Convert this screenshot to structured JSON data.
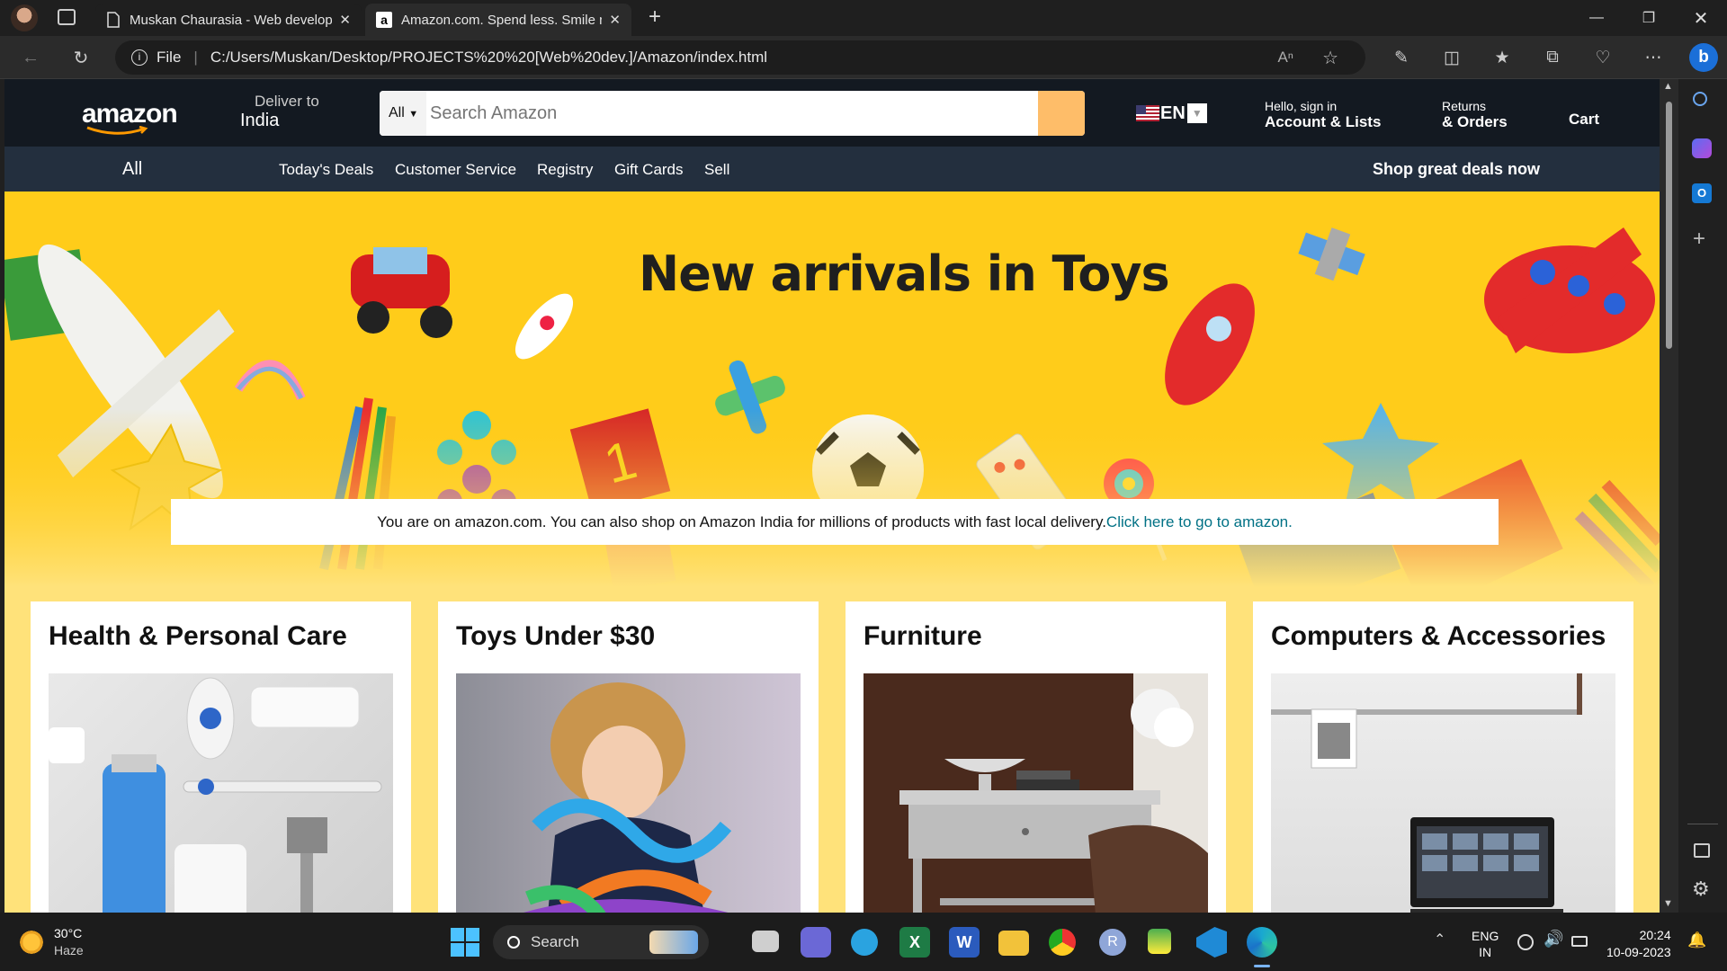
{
  "browser": {
    "tabs": [
      {
        "title": "Muskan Chaurasia - Web develop",
        "icon": "page-icon"
      },
      {
        "title": "Amazon.com. Spend less. Smile m",
        "icon": "amazon-a-icon"
      }
    ],
    "address": {
      "scheme": "File",
      "url": "C:/Users/Muskan/Desktop/PROJECTS%20%20[Web%20dev.]/Amazon/index.html"
    }
  },
  "amazon": {
    "logo": "amazon",
    "deliver_line1": "Deliver to",
    "deliver_line2": "India",
    "search_category": "All",
    "search_placeholder": "Search Amazon",
    "language": "EN",
    "account_line1": "Hello, sign in",
    "account_line2": "Account & Lists",
    "returns_line1": "Returns",
    "returns_line2": "& Orders",
    "cart": "Cart",
    "nav_all": "All",
    "nav_links": [
      "Today's Deals",
      "Customer Service",
      "Registry",
      "Gift Cards",
      "Sell"
    ],
    "nav_deals": "Shop great deals now",
    "hero_title": "New arrivals in Toys",
    "notice_text": "You are on amazon.com. You can also shop on Amazon India for millions of products with fast local delivery.",
    "notice_link": "Click here to go to amazon.",
    "cards": [
      {
        "title": "Health & Personal Care"
      },
      {
        "title": "Toys Under $30"
      },
      {
        "title": "Furniture"
      },
      {
        "title": "Computers & Accessories"
      }
    ]
  },
  "taskbar": {
    "weather_temp": "30°C",
    "weather_desc": "Haze",
    "search_label": "Search",
    "lang_line1": "ENG",
    "lang_line2": "IN",
    "time": "20:24",
    "date": "10-09-2023"
  },
  "colors": {
    "amazon_nav": "#131921",
    "amazon_subnav": "#232f3e",
    "search_button": "#febd69",
    "hero_yellow": "#ffcc1a",
    "link": "#007185"
  }
}
